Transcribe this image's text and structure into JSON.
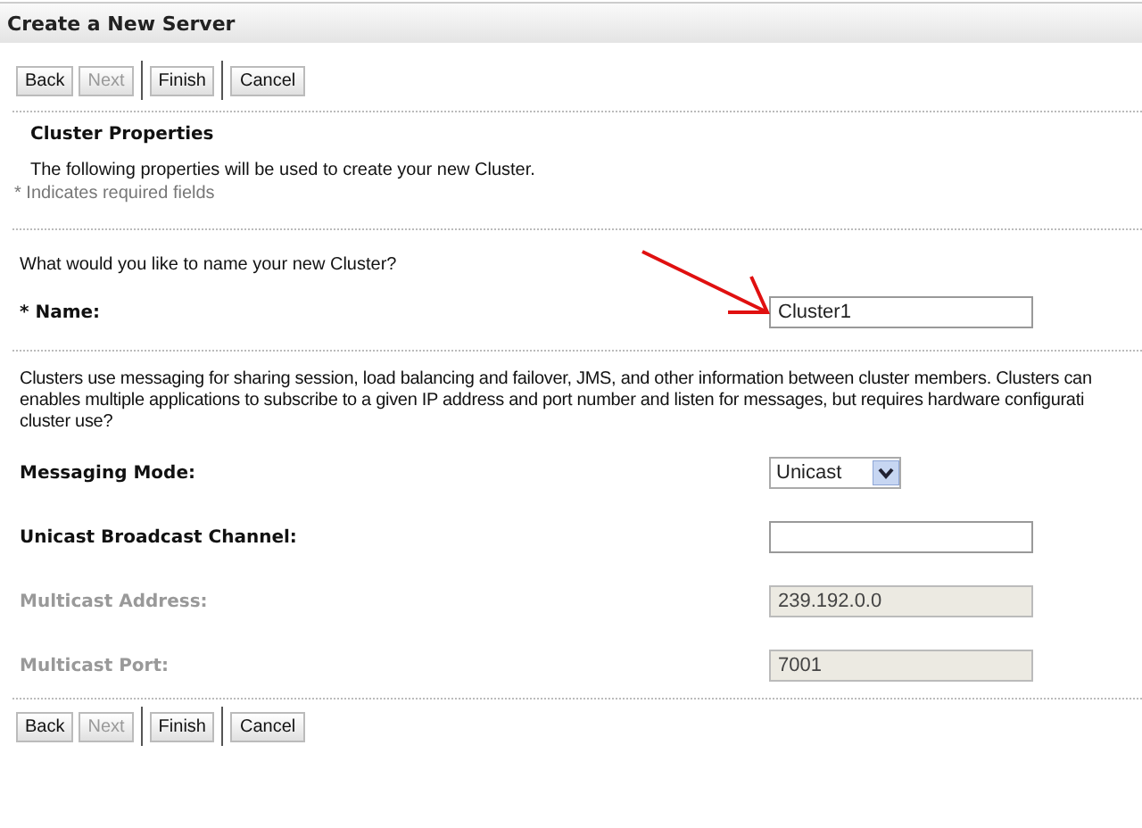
{
  "window": {
    "title": "Create a New Server"
  },
  "top_buttons": [
    {
      "label": "Back",
      "disabled": false
    },
    {
      "label": "Next",
      "disabled": true
    },
    {
      "label": "Finish",
      "disabled": false
    },
    {
      "label": "Cancel",
      "disabled": false
    }
  ],
  "section": {
    "title": "Cluster Properties",
    "description": "The following properties will be used to create your new Cluster.",
    "required_note": "* Indicates required fields"
  },
  "name_question": "What would you like to name your new Cluster?",
  "name_field": {
    "required_mark": "*",
    "label": "Name:",
    "value": "Cluster1"
  },
  "messaging_info": [
    "Clusters use messaging for sharing session, load balancing and failover, JMS, and other information between cluster members. Clusters can",
    "enables multiple applications to subscribe to a given IP address and port number and listen for messages, but requires hardware configurati",
    "cluster use?"
  ],
  "fields": [
    {
      "kind": "select",
      "label": "Messaging Mode:",
      "value": "Unicast",
      "disabled": false
    },
    {
      "kind": "text",
      "label": "Unicast Broadcast Channel:",
      "disabled": false
    },
    {
      "kind": "text",
      "label": "Multicast Address:",
      "value": "239.192.0.0",
      "disabled": true
    },
    {
      "kind": "text",
      "label": "Multicast Port:",
      "value": "7001",
      "disabled": true
    }
  ],
  "bottom_buttons": [
    {
      "label": "Back",
      "disabled": false
    },
    {
      "label": "Next",
      "disabled": true
    },
    {
      "label": "Finish",
      "disabled": false
    },
    {
      "label": "Cancel",
      "disabled": false
    }
  ]
}
